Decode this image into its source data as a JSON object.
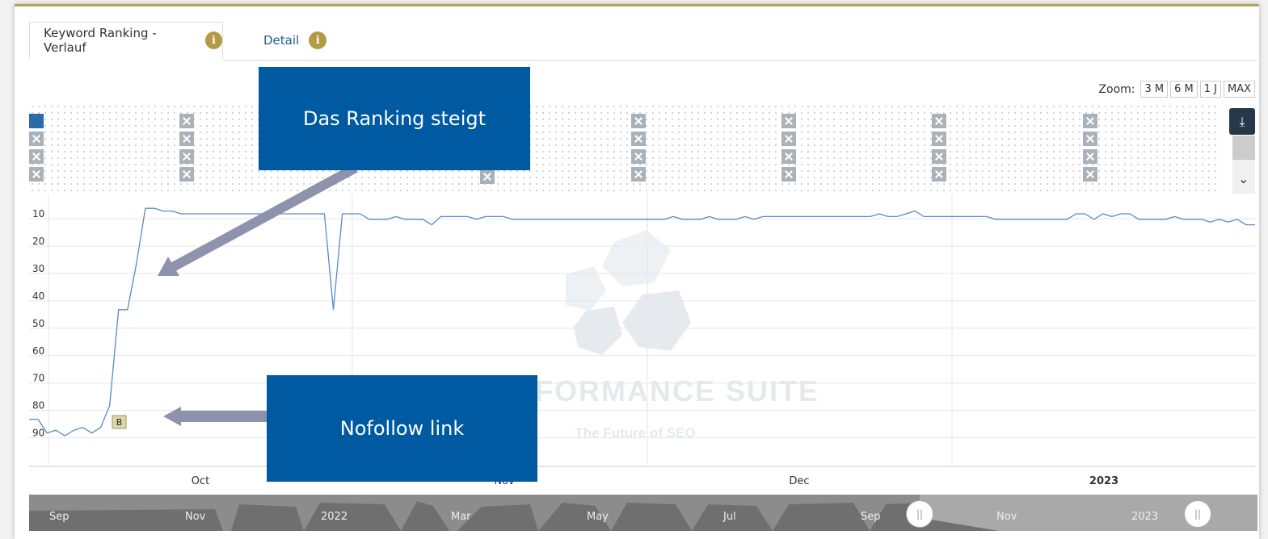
{
  "tabs": {
    "ranking_label": "Keyword Ranking - Verlauf",
    "detail_label": "Detail",
    "info_glyph": "i"
  },
  "zoom": {
    "label": "Zoom:",
    "options": [
      "3 M",
      "6 M",
      "1 J",
      "MAX"
    ]
  },
  "toolbar": {
    "download_icon": "download-icon",
    "download_glyph": "⤓",
    "scroll_down_glyph": "⌄"
  },
  "callouts": {
    "top": "Das Ranking steigt",
    "bottom": "Nofollow link"
  },
  "watermark": {
    "brand": "FORMANCE SUITE",
    "tagline": "The Future of SEO"
  },
  "marker": {
    "label": "B"
  },
  "colors": {
    "accent_gold": "#b59a45",
    "series_blue": "#5a8ac6",
    "callout_blue": "#005aa2",
    "arrow_gray": "#8e93ad"
  },
  "chart_data": {
    "type": "line",
    "y_axis": {
      "reversed": true,
      "ticks": [
        10,
        20,
        30,
        40,
        50,
        60,
        70,
        80,
        90
      ],
      "range": [
        5,
        100
      ]
    },
    "x_axis": {
      "tick_labels": [
        "Oct",
        "Nov",
        "Dec",
        "2023"
      ]
    },
    "series": [
      {
        "values": [
          85,
          85,
          90,
          89,
          91,
          89,
          88,
          90,
          88,
          80,
          45,
          45,
          28,
          8,
          8,
          9,
          9,
          10,
          10,
          10,
          10,
          10,
          10,
          10,
          10,
          10,
          10,
          10,
          10,
          10,
          10,
          10,
          10,
          10,
          45,
          10,
          10,
          10,
          12,
          12,
          12,
          11,
          12,
          12,
          12,
          14,
          11,
          11,
          11,
          11,
          12,
          11,
          11,
          11,
          12,
          12,
          12,
          12,
          12,
          12,
          12,
          12,
          12,
          12,
          12,
          12,
          12,
          12,
          12,
          12,
          12,
          12,
          11,
          12,
          12,
          12,
          11,
          12,
          12,
          12,
          11,
          12,
          11,
          11,
          11,
          11,
          11,
          11,
          11,
          11,
          11,
          11,
          11,
          11,
          11,
          10,
          11,
          11,
          10,
          9,
          11,
          11,
          11,
          11,
          11,
          11,
          11,
          11,
          12,
          12,
          12,
          12,
          12,
          12,
          12,
          12,
          12,
          10,
          10,
          12,
          10,
          11,
          10,
          10,
          12,
          12,
          12,
          12,
          11,
          12,
          12,
          12,
          13,
          12,
          13,
          12,
          14,
          14
        ]
      }
    ]
  },
  "navigator": {
    "labels": [
      "Sep",
      "Nov",
      "2022",
      "Mar",
      "May",
      "Jul",
      "Sep",
      "Nov",
      "2023"
    ],
    "handle_glyph": "||"
  }
}
